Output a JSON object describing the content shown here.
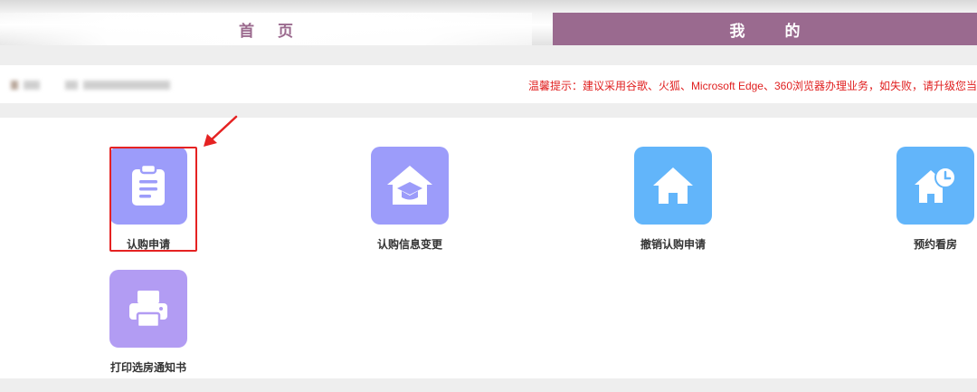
{
  "nav": {
    "home_label": "首页",
    "mine_label": "我的"
  },
  "notice": {
    "text": "温馨提示：建议采用谷歌、火狐、Microsoft Edge、360浏览器办理业务，如失败，请升级您当"
  },
  "tiles": [
    {
      "label": "认购申请",
      "icon": "clipboard-icon",
      "color": "#9c9cfa"
    },
    {
      "label": "认购信息变更",
      "icon": "house-graduation-cap-icon",
      "color": "#9c9cfa"
    },
    {
      "label": "撤销认购申请",
      "icon": "house-icon",
      "color": "#62b5fa"
    },
    {
      "label": "预约看房",
      "icon": "house-clock-icon",
      "color": "#62b5fa"
    },
    {
      "label": "打印选房通知书",
      "icon": "printer-icon",
      "color": "#b29cf3"
    }
  ],
  "annotation": {
    "highlight_color": "#e52222"
  }
}
